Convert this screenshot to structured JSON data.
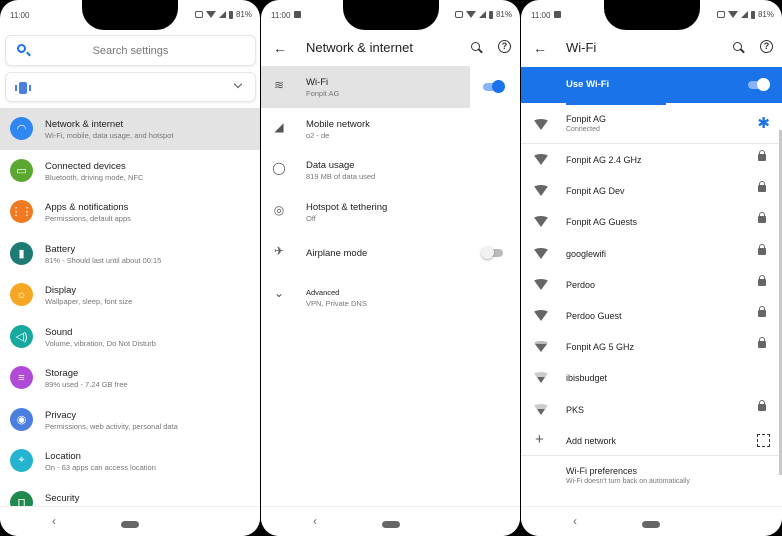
{
  "status_bar": {
    "time": "11:00",
    "battery": "81%"
  },
  "settings": {
    "search_placeholder": "Search settings",
    "items": [
      {
        "title": "Network & internet",
        "subtitle": "Wi-Fi, mobile, data usage, and hotspot",
        "color": "#2f87f1",
        "icon": "wifi-icon",
        "glyph": "◠"
      },
      {
        "title": "Connected devices",
        "subtitle": "Bluetooth, driving mode, NFC",
        "color": "#5aa830",
        "icon": "devices-icon",
        "glyph": "▭"
      },
      {
        "title": "Apps & notifications",
        "subtitle": "Permissions, default apps",
        "color": "#f07a22",
        "icon": "apps-grid-icon",
        "glyph": "⋮⋮"
      },
      {
        "title": "Battery",
        "subtitle": "81% - Should last until about 00:15",
        "color": "#1e7b73",
        "icon": "battery-icon",
        "glyph": "▮"
      },
      {
        "title": "Display",
        "subtitle": "Wallpaper, sleep, font size",
        "color": "#f5a623",
        "icon": "brightness-icon",
        "glyph": "☼"
      },
      {
        "title": "Sound",
        "subtitle": "Volume, vibration, Do Not Disturb",
        "color": "#17a8a0",
        "icon": "volume-icon",
        "glyph": "◁)"
      },
      {
        "title": "Storage",
        "subtitle": "89% used - 7.24 GB free",
        "color": "#b24ad8",
        "icon": "storage-icon",
        "glyph": "≡"
      },
      {
        "title": "Privacy",
        "subtitle": "Permissions, web activity, personal data",
        "color": "#4a7fe0",
        "icon": "privacy-eye-icon",
        "glyph": "◉"
      },
      {
        "title": "Location",
        "subtitle": "On - 63 apps can access location",
        "color": "#24b4cf",
        "icon": "location-pin-icon",
        "glyph": "⌖"
      },
      {
        "title": "Security",
        "subtitle": "",
        "color": "#1e8a4e",
        "icon": "lock-open-icon",
        "glyph": "⊓"
      }
    ]
  },
  "network": {
    "title": "Network & internet",
    "items": [
      {
        "title": "Wi-Fi",
        "subtitle": "Fonpit AG",
        "icon": "wifi-icon",
        "glyph": "≋",
        "toggle": "on"
      },
      {
        "title": "Mobile network",
        "subtitle": "o2 - de",
        "icon": "signal-icon",
        "glyph": "◢"
      },
      {
        "title": "Data usage",
        "subtitle": "819 MB of data used",
        "icon": "data-usage-icon",
        "glyph": "◯"
      },
      {
        "title": "Hotspot & tethering",
        "subtitle": "Off",
        "icon": "hotspot-icon",
        "glyph": "◎"
      },
      {
        "title": "Airplane mode",
        "subtitle": "",
        "icon": "airplane-icon",
        "glyph": "✈",
        "toggle": "off"
      },
      {
        "title": "Advanced",
        "subtitle": "VPN, Private DNS",
        "icon": "chevron-down-icon",
        "glyph": "⌄"
      }
    ]
  },
  "wifi": {
    "title": "Wi-Fi",
    "use_wifi_label": "Use Wi-Fi",
    "use_wifi_on": true,
    "connected": {
      "name": "Fonpit AG",
      "status": "Connected"
    },
    "networks": [
      {
        "name": "Fonpit AG 2.4 GHz",
        "strength": "full",
        "locked": true
      },
      {
        "name": "Fonpit AG Dev",
        "strength": "full",
        "locked": true
      },
      {
        "name": "Fonpit AG Guests",
        "strength": "full",
        "locked": true
      },
      {
        "name": "googlewifi",
        "strength": "full",
        "locked": true
      },
      {
        "name": "Perdoo",
        "strength": "full",
        "locked": true
      },
      {
        "name": "Perdoo Guest",
        "strength": "full",
        "locked": true
      },
      {
        "name": "Fonpit AG 5 GHz",
        "strength": "mid",
        "locked": true
      },
      {
        "name": "ibisbudget",
        "strength": "weak",
        "locked": false
      },
      {
        "name": "PKS",
        "strength": "weak",
        "locked": true
      }
    ],
    "add_network": "Add network",
    "prefs_title": "Wi-Fi preferences",
    "prefs_sub": "Wi-Fi doesn't turn back on automatically"
  }
}
